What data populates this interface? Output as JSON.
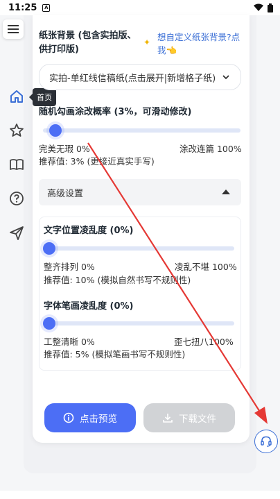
{
  "status_bar": {
    "time": "11:25",
    "notification_letter": "A"
  },
  "sidebar": {
    "tooltip": "首页",
    "items": [
      "home-icon",
      "star-icon",
      "book-icon",
      "help-icon",
      "send-icon"
    ]
  },
  "paper": {
    "label": "纸张背景 (包含实拍版、供打印版)",
    "hint": "想自定义纸张背景?点我👈",
    "selected": "实拍-单红线信稿纸(点击展开|新增格子纸)"
  },
  "doodle": {
    "label": "随机勾画涂改概率 (3%，可滑动修改)",
    "value": 0.03,
    "min_label": "完美无瑕 0%",
    "max_label": "涂改连篇 100%",
    "recommend": "推荐值: 3% (更接近真实手写)"
  },
  "advanced": {
    "title": "高级设置",
    "position": {
      "label": "文字位置凌乱度 (0%)",
      "value": 0,
      "min_label": "整齐排列 0%",
      "max_label": "凌乱不堪 100%",
      "recommend": "推荐值: 10% (模拟自然书写不规则性)"
    },
    "stroke": {
      "label": "字体笔画凌乱度 (0%)",
      "value": 0,
      "min_label": "工整清晰 0%",
      "max_label": "歪七扭八100%",
      "recommend": "推荐值: 5% (模拟笔画书写不规则性)"
    }
  },
  "actions": {
    "preview": "点击预览",
    "download": "下载文件"
  },
  "colors": {
    "accent": "#4c6ef5",
    "link": "#3b6fd6",
    "arrow": "#e53935",
    "disabled": "#d1d3d6"
  }
}
